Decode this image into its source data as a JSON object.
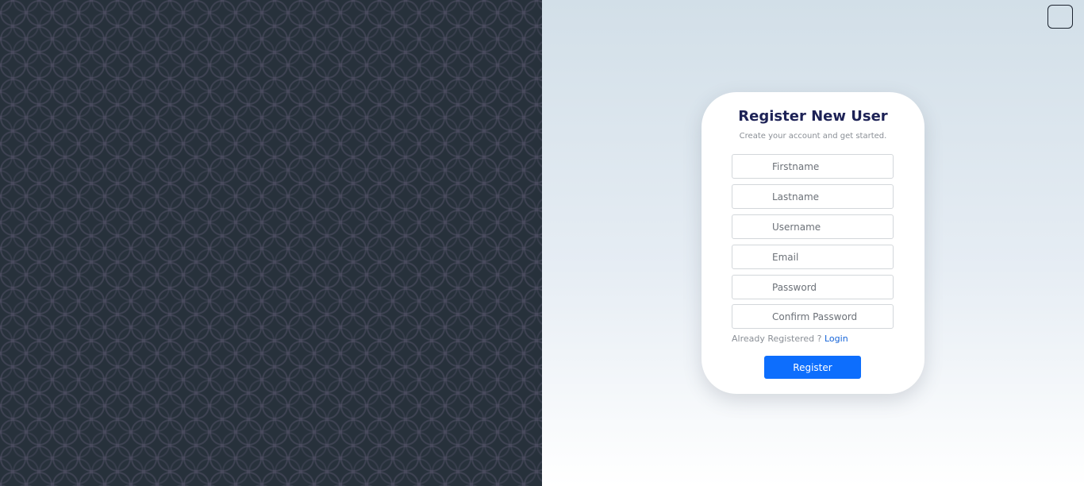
{
  "form": {
    "title": "Register New User",
    "subtitle": "Create your account and get started.",
    "fields": [
      {
        "placeholder": "Firstname",
        "value": ""
      },
      {
        "placeholder": "Lastname",
        "value": ""
      },
      {
        "placeholder": "Username",
        "value": ""
      },
      {
        "placeholder": "Email",
        "value": ""
      },
      {
        "placeholder": "Password",
        "value": ""
      },
      {
        "placeholder": "Confirm Password",
        "value": ""
      }
    ],
    "already_registered_text": "Already Registered ?",
    "login_link_label": "Login",
    "register_button_label": "Register"
  },
  "colors": {
    "left_panel_bg": "#27313b",
    "title": "#1d2256",
    "link": "#1463d8",
    "primary_button": "#0d6efd"
  }
}
